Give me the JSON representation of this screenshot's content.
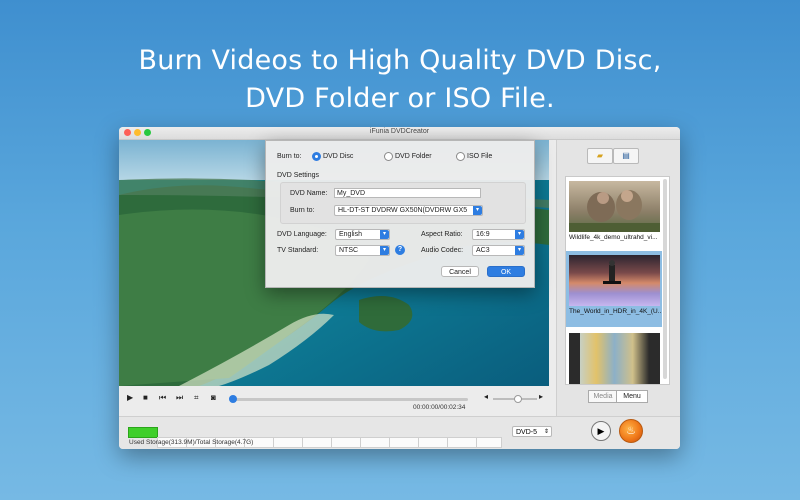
{
  "headline": {
    "line1": "Burn Videos to High Quality DVD Disc,",
    "line2": "DVD Folder or ISO File."
  },
  "window": {
    "title": "iFunia DVDCreator",
    "traffic_colors": [
      "#fd5f57",
      "#febc2e",
      "#28c840"
    ]
  },
  "player": {
    "time": "00:00:00/00:02:34",
    "progress": 0.0,
    "volume": 0.7,
    "icons": [
      "play-icon",
      "stop-icon",
      "prev-icon",
      "next-icon",
      "crop-icon",
      "snapshot-icon",
      "volume-down-icon",
      "volume-up-icon"
    ]
  },
  "dialog": {
    "burn_to_label": "Burn to:",
    "options": [
      "DVD Disc",
      "DVD Folder",
      "ISO File"
    ],
    "selected_option": "DVD Disc",
    "dvd_settings_label": "DVD Settings",
    "dvd_name_label": "DVD Name:",
    "dvd_name_value": "My_DVD",
    "burn_to_device_label": "Burn to:",
    "burn_to_device_value": "HL-DT-ST DVDRW GX50N(DVDRW  GX5",
    "dvd_language_label": "DVD Language:",
    "dvd_language_value": "English",
    "aspect_ratio_label": "Aspect Ratio:",
    "aspect_ratio_value": "16:9",
    "tv_standard_label": "TV Standard:",
    "tv_standard_value": "NTSC",
    "audio_codec_label": "Audio Codec:",
    "audio_codec_value": "AC3",
    "help": "?",
    "cancel": "Cancel",
    "ok": "OK"
  },
  "sidebar": {
    "items": [
      {
        "label": "Wildlife_4k_demo_ultrahd_vi..."
      },
      {
        "label": "The_World_in_HDR_in_4K_(U..."
      },
      {
        "label": ""
      }
    ],
    "selected_index": 1,
    "segments": [
      "Media",
      "Menu"
    ],
    "active_segment": "Menu"
  },
  "bottom": {
    "storage_text": "Used Storage(313.9M)/Total Storage(4.7G)",
    "storage_fill": 0.067,
    "disc_type": "DVD-5"
  },
  "colors": {
    "accent": "#2e7de1",
    "storage_green": "#3fcf2a",
    "burn_orange": "#f07a1a"
  }
}
